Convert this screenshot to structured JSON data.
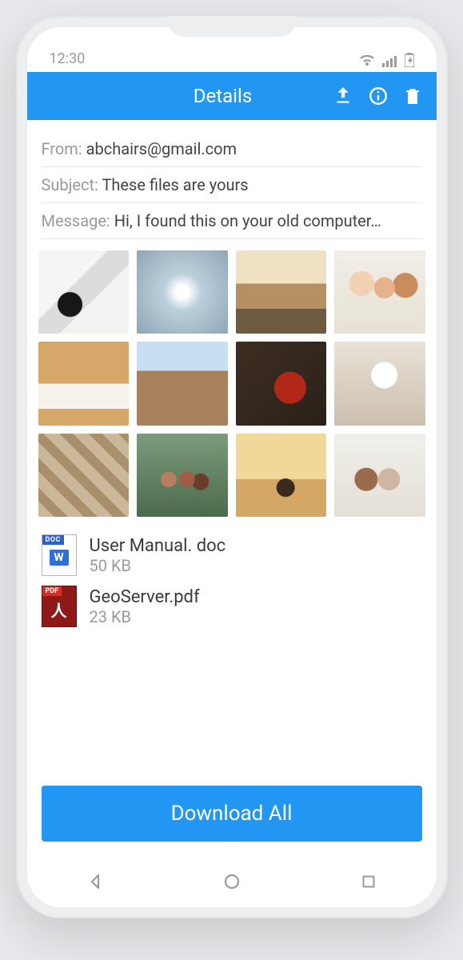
{
  "status": {
    "time": "12:30"
  },
  "header": {
    "title": "Details",
    "icons": {
      "upload": "upload-icon",
      "info": "info-icon",
      "trash": "trash-icon"
    }
  },
  "meta": {
    "from_label": "From:",
    "from_value": "abchairs@gmail.com",
    "subject_label": "Subject:",
    "subject_value": "These files are yours",
    "message_label": "Message:",
    "message_value": "Hi, I found this on your old computer…"
  },
  "attachments": {
    "images": [
      {
        "name": "image-chair"
      },
      {
        "name": "image-frost"
      },
      {
        "name": "image-room"
      },
      {
        "name": "image-group-selfie"
      },
      {
        "name": "image-sketch"
      },
      {
        "name": "image-balcony"
      },
      {
        "name": "image-hands"
      },
      {
        "name": "image-builder"
      },
      {
        "name": "image-leaves"
      },
      {
        "name": "image-friends"
      },
      {
        "name": "image-sunset"
      },
      {
        "name": "image-walking"
      }
    ],
    "files": [
      {
        "icon": "doc",
        "tab": "DOC",
        "name": "User Manual. doc",
        "size": "50 KB"
      },
      {
        "icon": "pdf",
        "tab": "PDF",
        "name": "GeoServer.pdf",
        "size": "23 KB"
      }
    ]
  },
  "actions": {
    "download_all": "Download All"
  }
}
